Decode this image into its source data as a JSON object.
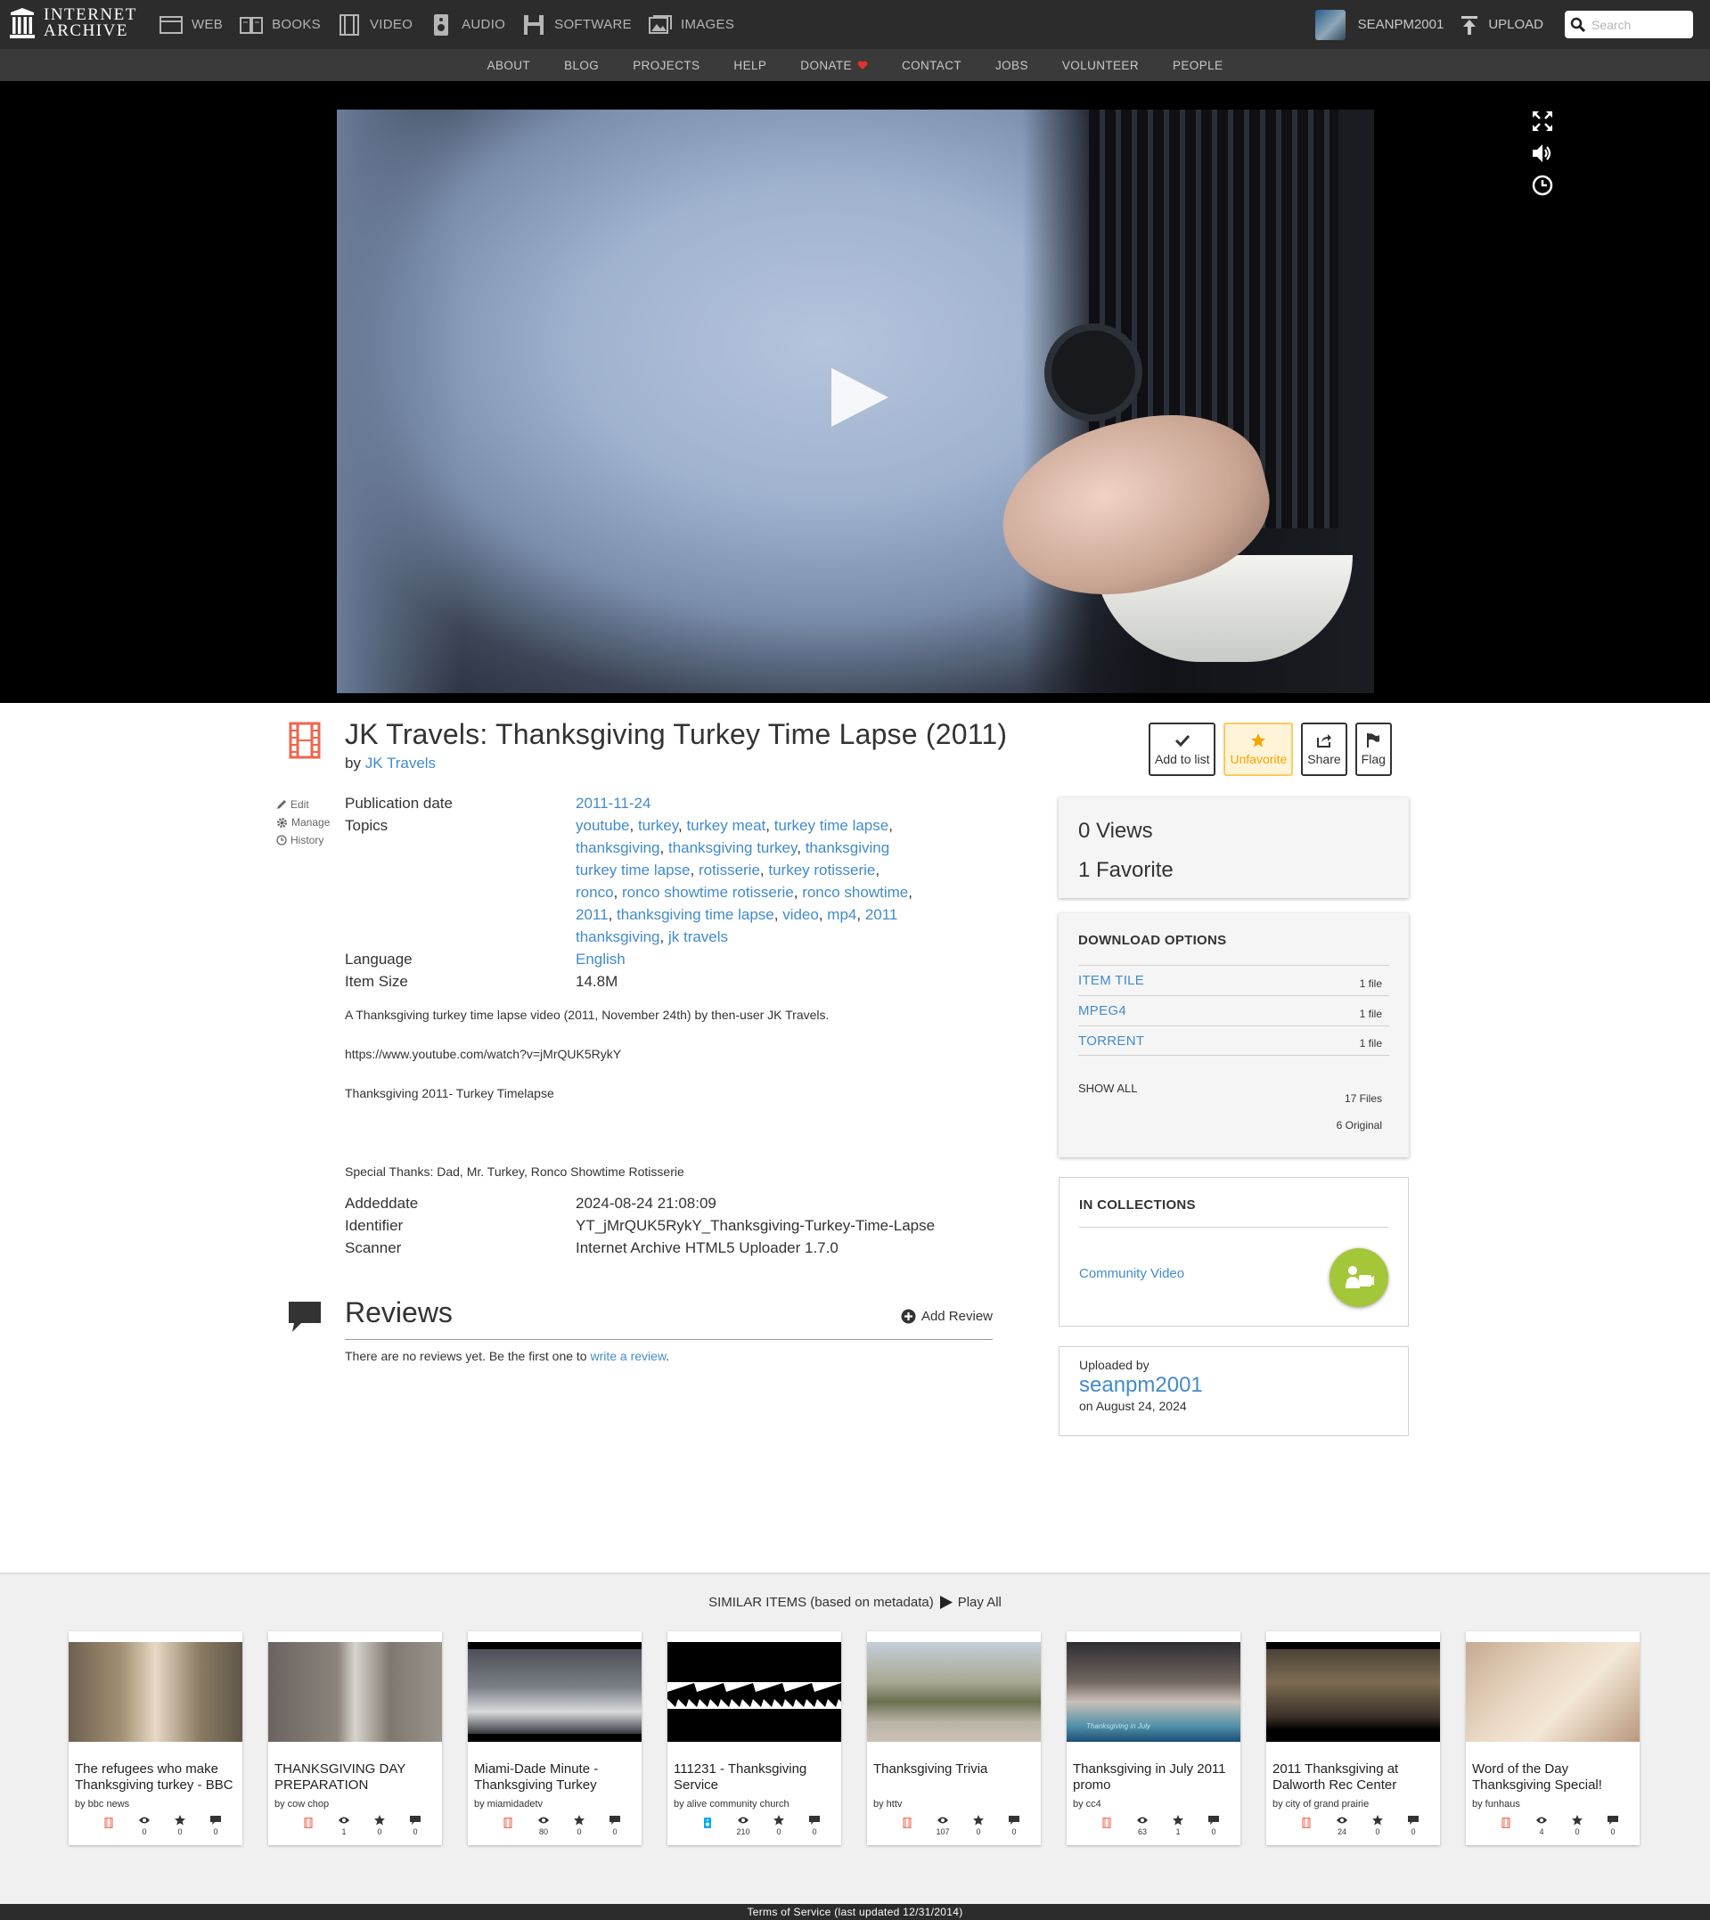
{
  "topnav": {
    "logo_line1": "INTERNET",
    "logo_line2": "ARCHIVE",
    "mediatypes": [
      "WEB",
      "BOOKS",
      "VIDEO",
      "AUDIO",
      "SOFTWARE",
      "IMAGES"
    ],
    "username": "SEANPM2001",
    "upload_label": "UPLOAD",
    "search_placeholder": "Search"
  },
  "subnav": [
    "ABOUT",
    "BLOG",
    "PROJECTS",
    "HELP",
    "DONATE",
    "CONTACT",
    "JOBS",
    "VOLUNTEER",
    "PEOPLE"
  ],
  "item": {
    "title": "JK Travels: Thanksgiving Turkey Time Lapse (2011)",
    "by_prefix": "by",
    "creator": "JK Travels",
    "actions": [
      "Add to list",
      "Unfavorite",
      "Share",
      "Flag"
    ],
    "side_links": [
      "Edit",
      "Manage",
      "History"
    ],
    "publication_label": "Publication date",
    "publication_date": "2011-11-24",
    "topics_label": "Topics",
    "topics": [
      "youtube",
      "turkey",
      "turkey meat",
      "turkey time lapse",
      "thanksgiving",
      "thanksgiving turkey",
      "thanksgiving turkey time lapse",
      "rotisserie",
      "turkey rotisserie",
      "ronco",
      "ronco showtime rotisserie",
      "ronco showtime",
      "2011",
      "thanksgiving time lapse",
      "video",
      "mp4",
      "2011 thanksgiving",
      "jk travels"
    ],
    "language_label": "Language",
    "language": "English",
    "size_label": "Item Size",
    "size": "14.8M",
    "description": [
      "A Thanksgiving turkey time lapse video (2011, November 24th) by then-user JK Travels.",
      "https://www.youtube.com/watch?v=jMrQUK5RykY",
      "Thanksgiving 2011- Turkey Timelapse",
      "Special Thanks: Dad, Mr. Turkey, Ronco Showtime Rotisserie"
    ],
    "addeddate_label": "Addeddate",
    "addeddate": "2024-08-24 21:08:09",
    "identifier_label": "Identifier",
    "identifier": "YT_jMrQUK5RykY_Thanksgiving-Turkey-Time-Lapse",
    "scanner_label": "Scanner",
    "scanner": "Internet Archive HTML5 Uploader 1.7.0"
  },
  "reviews": {
    "title": "Reviews",
    "add_label": "Add Review",
    "empty_text": "There are no reviews yet. Be the first one to",
    "empty_link": "write a review",
    "empty_end": "."
  },
  "stats": {
    "views": "0 Views",
    "favorites": "1 Favorite"
  },
  "downloads": {
    "heading": "DOWNLOAD OPTIONS",
    "rows": [
      {
        "label": "ITEM TILE",
        "count": "1 file"
      },
      {
        "label": "MPEG4",
        "count": "1 file"
      },
      {
        "label": "TORRENT",
        "count": "1 file"
      }
    ],
    "show_all": "SHOW ALL",
    "total_files": "17 Files",
    "original_files": "6 Original"
  },
  "collections": {
    "heading": "IN COLLECTIONS",
    "items": [
      "Community Video"
    ]
  },
  "uploader": {
    "label": "Uploaded by",
    "name": "seanpm2001",
    "date": "on August 24, 2024"
  },
  "similar": {
    "heading": "SIMILAR ITEMS (based on metadata)",
    "play_all": "Play All",
    "items": [
      {
        "title": "The refugees who make Thanksgiving turkey - BBC",
        "by": "by bbc news",
        "type": "movies",
        "views": "0",
        "favs": "0",
        "reviews": "0"
      },
      {
        "title": "THANKSGIVING DAY PREPARATION",
        "by": "by cow chop",
        "type": "movies",
        "views": "1",
        "favs": "0",
        "reviews": "0"
      },
      {
        "title": "Miami-Dade Minute - Thanksgiving Turkey",
        "by": "by miamidadetv",
        "type": "movies",
        "views": "80",
        "favs": "0",
        "reviews": "0"
      },
      {
        "title": "111231 - Thanksgiving Service",
        "by": "by alive community church",
        "type": "audio",
        "views": "210",
        "favs": "0",
        "reviews": "0"
      },
      {
        "title": "Thanksgiving Trivia",
        "by": "by httv",
        "type": "movies",
        "views": "107",
        "favs": "0",
        "reviews": "0"
      },
      {
        "title": "Thanksgiving in July 2011 promo",
        "by": "by cc4",
        "type": "movies",
        "views": "63",
        "favs": "1",
        "reviews": "0"
      },
      {
        "title": "2011 Thanksgiving at Dalworth Rec Center",
        "by": "by city of grand prairie",
        "type": "movies",
        "views": "24",
        "favs": "0",
        "reviews": "0"
      },
      {
        "title": "Word of the Day Thanksgiving Special!",
        "by": "by funhaus",
        "type": "movies",
        "views": "4",
        "favs": "0",
        "reviews": "0"
      }
    ]
  },
  "thumb_overlay": "Thanksgiving in July",
  "footer": "Terms of Service (last updated 12/31/2014)",
  "colors": {
    "accent": "#428bca",
    "movie_icon": "#f1644b",
    "audio_icon": "#00adef",
    "collection": "#a4c639",
    "favorite": "#f6a400"
  }
}
